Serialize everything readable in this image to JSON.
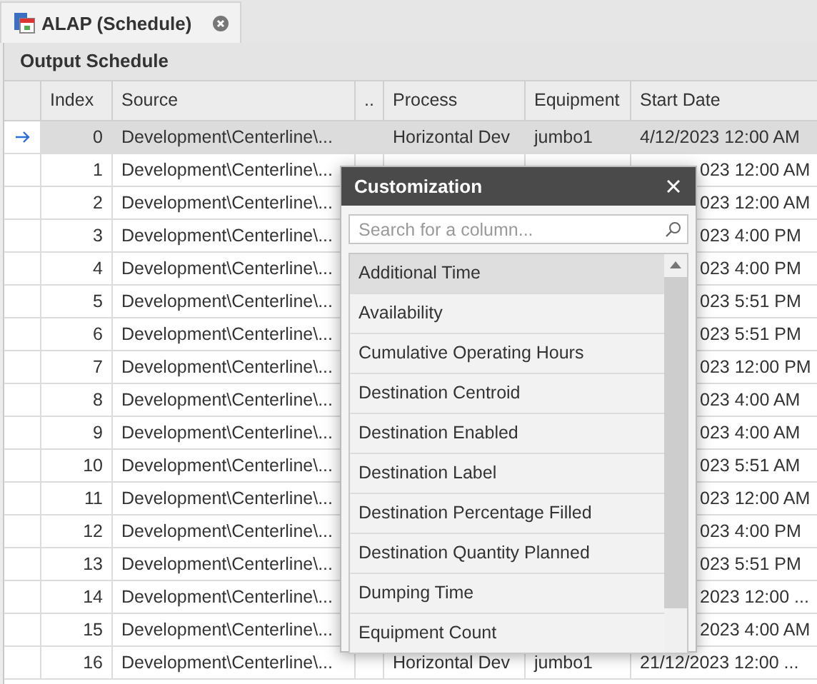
{
  "tab": {
    "title": "ALAP (Schedule)"
  },
  "panel_title": "Output Schedule",
  "table": {
    "columns": [
      "Index",
      "Source",
      "..",
      "Process",
      "Equipment",
      "Start Date"
    ],
    "rows": [
      {
        "index": "0",
        "source": "Development\\Centerline\\...",
        "process": "Horizontal Dev",
        "equipment": "jumbo1",
        "start_date": "4/12/2023 12:00 AM",
        "selected": true
      },
      {
        "index": "1",
        "source": "Development\\Centerline\\...",
        "start_date": "023 12:00 AM",
        "selected": false
      },
      {
        "index": "2",
        "source": "Development\\Centerline\\...",
        "start_date": "023 12:00 AM",
        "selected": false
      },
      {
        "index": "3",
        "source": "Development\\Centerline\\...",
        "start_date": "023 4:00 PM",
        "selected": false
      },
      {
        "index": "4",
        "source": "Development\\Centerline\\...",
        "start_date": "023 4:00 PM",
        "selected": false
      },
      {
        "index": "5",
        "source": "Development\\Centerline\\...",
        "start_date": "023 5:51 PM",
        "selected": false
      },
      {
        "index": "6",
        "source": "Development\\Centerline\\...",
        "start_date": "023 5:51 PM",
        "selected": false
      },
      {
        "index": "7",
        "source": "Development\\Centerline\\...",
        "start_date": "023 12:00 PM",
        "selected": false
      },
      {
        "index": "8",
        "source": "Development\\Centerline\\...",
        "start_date": "023 4:00 AM",
        "selected": false
      },
      {
        "index": "9",
        "source": "Development\\Centerline\\...",
        "start_date": "023 4:00 AM",
        "selected": false
      },
      {
        "index": "10",
        "source": "Development\\Centerline\\...",
        "start_date": "023 5:51 AM",
        "selected": false
      },
      {
        "index": "11",
        "source": "Development\\Centerline\\...",
        "start_date": "023 12:00 AM",
        "selected": false
      },
      {
        "index": "12",
        "source": "Development\\Centerline\\...",
        "start_date": "023 4:00 PM",
        "selected": false
      },
      {
        "index": "13",
        "source": "Development\\Centerline\\...",
        "start_date": "023 5:51 PM",
        "selected": false
      },
      {
        "index": "14",
        "source": "Development\\Centerline\\...",
        "start_date": "2023 12:00 ...",
        "selected": false
      },
      {
        "index": "15",
        "source": "Development\\Centerline\\...",
        "start_date": "2023 4:00 AM",
        "selected": false
      },
      {
        "index": "16",
        "source": "Development\\Centerline\\...",
        "process": "Horizontal Dev",
        "equipment": "jumbo1",
        "start_date": "21/12/2023 12:00 ...",
        "selected": false
      }
    ]
  },
  "customization": {
    "title": "Customization",
    "search": {
      "placeholder": "Search for a column..."
    },
    "items": [
      {
        "label": "Additional Time",
        "selected": true
      },
      {
        "label": "Availability",
        "selected": false
      },
      {
        "label": "Cumulative Operating Hours",
        "selected": false
      },
      {
        "label": "Destination Centroid",
        "selected": false
      },
      {
        "label": "Destination Enabled",
        "selected": false
      },
      {
        "label": "Destination Label",
        "selected": false
      },
      {
        "label": "Destination Percentage Filled",
        "selected": false
      },
      {
        "label": "Destination Quantity Planned",
        "selected": false
      },
      {
        "label": "Dumping Time",
        "selected": false
      },
      {
        "label": "Equipment Count",
        "selected": false
      }
    ]
  }
}
